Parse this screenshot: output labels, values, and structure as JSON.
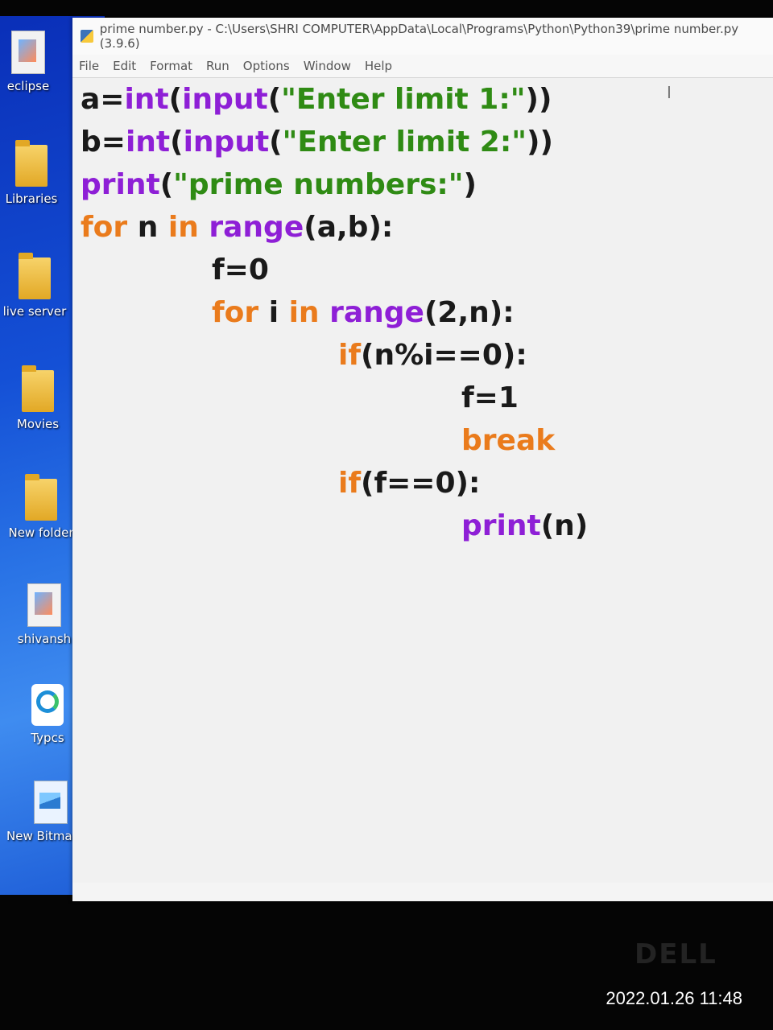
{
  "window": {
    "title": "prime number.py - C:\\Users\\SHRI COMPUTER\\AppData\\Local\\Programs\\Python\\Python39\\prime number.py (3.9.6)"
  },
  "menu": [
    "File",
    "Edit",
    "Format",
    "Run",
    "Options",
    "Window",
    "Help"
  ],
  "desktop_icons": [
    {
      "label": "eclipse",
      "icon": "file-icon"
    },
    {
      "label": "Libraries",
      "icon": "folder-icon"
    },
    {
      "label": "live server",
      "icon": "folder-icon"
    },
    {
      "label": "Movies",
      "icon": "folder-icon"
    },
    {
      "label": "New folder",
      "icon": "folder-icon"
    },
    {
      "label": "shivansh",
      "icon": "image-icon"
    },
    {
      "label": "Typcs",
      "icon": "edge-icon"
    },
    {
      "label": "New Bitmap Image",
      "icon": "bitmap-icon"
    }
  ],
  "code_lines": [
    {
      "indent": 0,
      "tokens": [
        {
          "t": "a=",
          "c": "df"
        },
        {
          "t": "int",
          "c": "bi"
        },
        {
          "t": "(",
          "c": "df"
        },
        {
          "t": "input",
          "c": "bi"
        },
        {
          "t": "(",
          "c": "df"
        },
        {
          "t": "\"Enter limit 1:\"",
          "c": "str"
        },
        {
          "t": "))",
          "c": "df"
        }
      ]
    },
    {
      "indent": 0,
      "tokens": [
        {
          "t": "b=",
          "c": "df"
        },
        {
          "t": "int",
          "c": "bi"
        },
        {
          "t": "(",
          "c": "df"
        },
        {
          "t": "input",
          "c": "bi"
        },
        {
          "t": "(",
          "c": "df"
        },
        {
          "t": "\"Enter limit 2:\"",
          "c": "str"
        },
        {
          "t": "))",
          "c": "df"
        }
      ]
    },
    {
      "indent": 0,
      "tokens": [
        {
          "t": "print",
          "c": "bi"
        },
        {
          "t": "(",
          "c": "df"
        },
        {
          "t": "\"prime numbers:\"",
          "c": "str"
        },
        {
          "t": ")",
          "c": "df"
        }
      ]
    },
    {
      "indent": 0,
      "tokens": [
        {
          "t": "for",
          "c": "kw"
        },
        {
          "t": " n ",
          "c": "df"
        },
        {
          "t": "in",
          "c": "kw"
        },
        {
          "t": " ",
          "c": "df"
        },
        {
          "t": "range",
          "c": "bi"
        },
        {
          "t": "(a,b):",
          "c": "df"
        }
      ]
    },
    {
      "indent": 1,
      "tokens": [
        {
          "t": "f=0",
          "c": "df"
        }
      ]
    },
    {
      "indent": 1,
      "tokens": [
        {
          "t": "for",
          "c": "kw"
        },
        {
          "t": " i ",
          "c": "df"
        },
        {
          "t": "in",
          "c": "kw"
        },
        {
          "t": " ",
          "c": "df"
        },
        {
          "t": "range",
          "c": "bi"
        },
        {
          "t": "(2,n):",
          "c": "df"
        }
      ]
    },
    {
      "indent": 2,
      "tokens": [
        {
          "t": "if",
          "c": "kw"
        },
        {
          "t": "(n%i==0):",
          "c": "df"
        }
      ]
    },
    {
      "indent": 3,
      "tokens": [
        {
          "t": "f=1",
          "c": "df"
        }
      ]
    },
    {
      "indent": 3,
      "tokens": [
        {
          "t": "break",
          "c": "kw"
        }
      ]
    },
    {
      "indent": 2,
      "tokens": [
        {
          "t": "if",
          "c": "kw"
        },
        {
          "t": "(f==0):",
          "c": "df"
        }
      ]
    },
    {
      "indent": 3,
      "tokens": [
        {
          "t": "print",
          "c": "bi"
        },
        {
          "t": "(n)",
          "c": "df"
        }
      ]
    }
  ],
  "bezel": {
    "brand": "DELL"
  },
  "photo_timestamp": "2022.01.26 11:48"
}
